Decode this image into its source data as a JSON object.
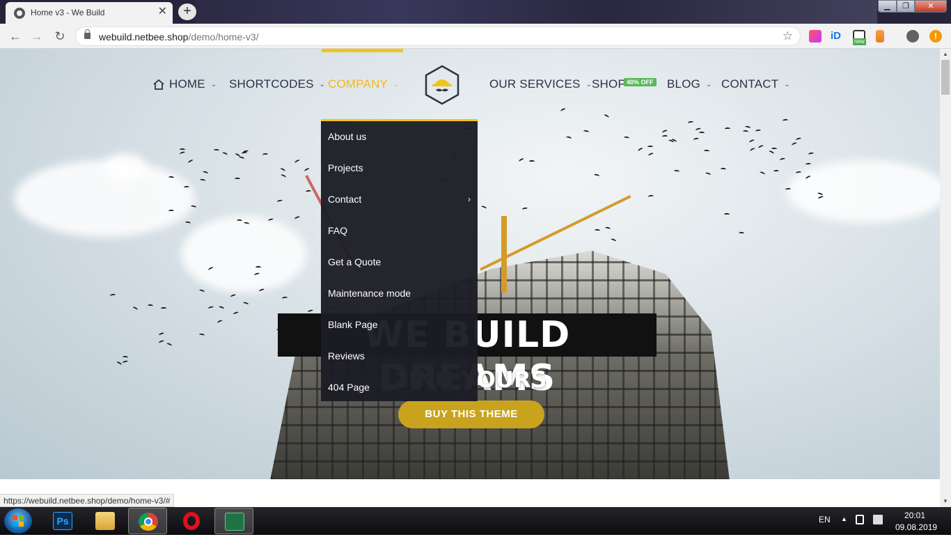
{
  "browser": {
    "tab_title": "Home v3 - We Build",
    "tab_close": "✕",
    "new_tab": "+",
    "url_host": "webuild.netbee.shop",
    "url_path": "/demo/home-v3/",
    "status_url": "https://webuild.netbee.shop/demo/home-v3/#",
    "window_min": "▁",
    "window_max": "❐",
    "window_close": "✕",
    "back": "←",
    "forward": "→",
    "reload": "↻",
    "bookmark": "☆",
    "ext_badge": "new"
  },
  "nav": {
    "items": [
      {
        "label": "HOME"
      },
      {
        "label": "SHORTCODES"
      },
      {
        "label": "COMPANY"
      },
      {
        "label": "OUR SERVICES"
      },
      {
        "label": "SHOP"
      },
      {
        "label": "BLOG"
      },
      {
        "label": "CONTACT"
      }
    ],
    "shop_badge": "40% OFF",
    "chevron": "⌄"
  },
  "dropdown": {
    "items": [
      {
        "label": "About us"
      },
      {
        "label": "Projects"
      },
      {
        "label": "Contact"
      },
      {
        "label": "FAQ"
      },
      {
        "label": "Get a Quote"
      },
      {
        "label": "Maintenance mode"
      },
      {
        "label": "Blank Page"
      },
      {
        "label": "Reviews"
      },
      {
        "label": "404 Page"
      }
    ],
    "submenu_arrow": "›"
  },
  "hero": {
    "headline": "WE BUILD DREAMS",
    "subline": "…ING YOURS",
    "cta": "BUY THIS THEME"
  },
  "taskbar": {
    "language": "EN",
    "time": "20:01",
    "date": "09.08.2019",
    "ps_label": "Ps"
  },
  "colors": {
    "accent": "#f3c31c",
    "nav_text": "#2c3144",
    "dropdown_bg": "#1c1d24",
    "cta": "#c9a31e",
    "badge": "#5cb85c"
  }
}
